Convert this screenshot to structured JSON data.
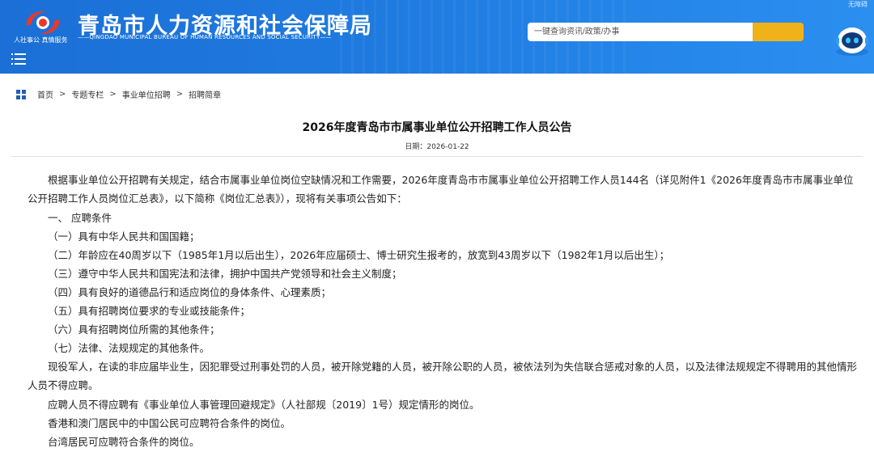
{
  "header": {
    "title": "青岛市人力资源和社会保障局",
    "subtitle": "——QINGDAO MUNICIPAL BUREAU OF HUMAN RESOURCES AND SOCIAL SECURITY——",
    "slogan": "人社事公 真情服务",
    "access_link": "无障碍",
    "search_placeholder": "一键查询资讯/政策/办事",
    "colors": {
      "banner": "#1f7be0",
      "search_button": "#f0b21a"
    }
  },
  "breadcrumb": [
    "首页",
    "专题专栏",
    "事业单位招聘",
    "招聘简章"
  ],
  "breadcrumb_sep": ">",
  "article": {
    "title": "2026年度青岛市市属事业单位公开招聘工作人员公告",
    "date": "日期：2026-01-22",
    "paragraphs": [
      "根据事业单位公开招聘有关规定，结合市属事业单位岗位空缺情况和工作需要，2026年度青岛市市属事业单位公开招聘工作人员144名（详见附件1《2026年度青岛市市属事业单位公开招聘工作人员岗位汇总表》，以下简称《岗位汇总表》），现将有关事项公告如下：",
      "一、 应聘条件",
      "（一）具有中华人民共和国国籍；",
      "（二）年龄应在40周岁以下（1985年1月以后出生），2026年应届硕士、博士研究生报考的，放宽到43周岁以下（1982年1月以后出生）；",
      "（三）遵守中华人民共和国宪法和法律，拥护中国共产党领导和社会主义制度；",
      "（四）具有良好的道德品行和适应岗位的身体条件、心理素质；",
      "（五）具有招聘岗位要求的专业或技能条件；",
      "（六）具有招聘岗位所需的其他条件；",
      "（七）法律、法规规定的其他条件。",
      "现役军人，在读的非应届毕业生，因犯罪受过刑事处罚的人员，被开除党籍的人员，被开除公职的人员，被依法列为失信联合惩戒对象的人员，以及法律法规规定不得聘用的其他情形人员不得应聘。",
      "应聘人员不得应聘有《事业单位人事管理回避规定》（人社部规〔2019〕1号）规定情形的岗位。",
      "香港和澳门居民中的中国公民可应聘符合条件的岗位。",
      "台湾居民可应聘符合条件的岗位。"
    ]
  },
  "icons": [
    "logo-emblem-icon",
    "menu-icon",
    "search-icon",
    "robot-assistant-icon",
    "grid-icon"
  ]
}
